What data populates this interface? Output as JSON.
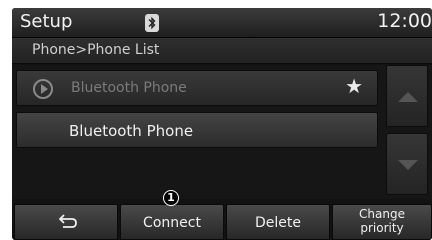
{
  "header": {
    "title": "Setup",
    "bluetooth_icon": "bluetooth-icon",
    "time": "12:00"
  },
  "breadcrumb": {
    "text": "Phone>Phone List"
  },
  "phone_list": {
    "items": [
      {
        "label": "Bluetooth Phone",
        "icon": "play-circle-icon",
        "favorite": true,
        "dimmed": true
      },
      {
        "label": "Bluetooth Phone",
        "icon": null,
        "favorite": false,
        "dimmed": false
      }
    ]
  },
  "scroll": {
    "up_icon": "arrow-up-icon",
    "down_icon": "arrow-down-icon"
  },
  "bottom_bar": {
    "back_icon": "back-arrow-icon",
    "connect_label": "Connect",
    "delete_label": "Delete",
    "change_priority_line1": "Change",
    "change_priority_line2": "priority"
  },
  "annotation": {
    "marker": "1"
  }
}
